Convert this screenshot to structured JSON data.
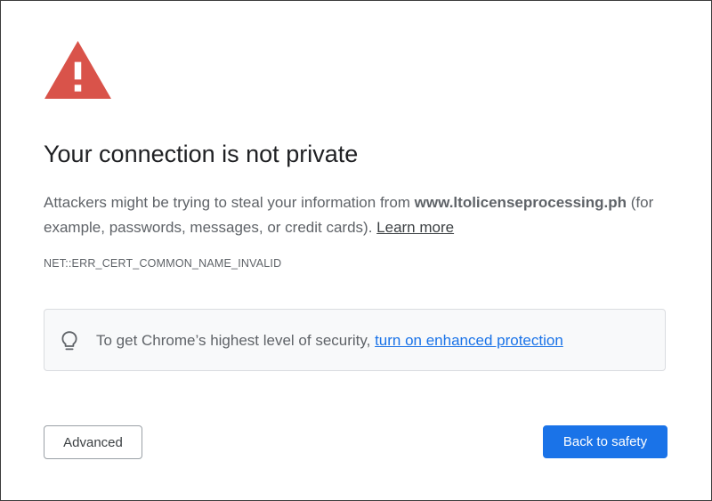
{
  "interstitial": {
    "title": "Your connection is not private",
    "description": {
      "prefix": "Attackers might be trying to steal your information from ",
      "domain": "www.ltolicenseprocessing.ph",
      "suffix": " (for example, passwords, messages, or credit cards). ",
      "learn_more_label": "Learn more"
    },
    "error_code": "NET::ERR_CERT_COMMON_NAME_INVALID",
    "enhanced_protection": {
      "icon": "lightbulb-icon",
      "text": "To get Chrome’s highest level of security, ",
      "link_label": "turn on enhanced protection"
    },
    "buttons": {
      "advanced_label": "Advanced",
      "back_to_safety_label": "Back to safety"
    },
    "icons": {
      "warning": "warning-triangle-icon"
    },
    "colors": {
      "warning_red": "#d9534a",
      "primary_blue": "#1a73e8",
      "text_gray": "#5f6368",
      "title_text": "#202124"
    }
  }
}
